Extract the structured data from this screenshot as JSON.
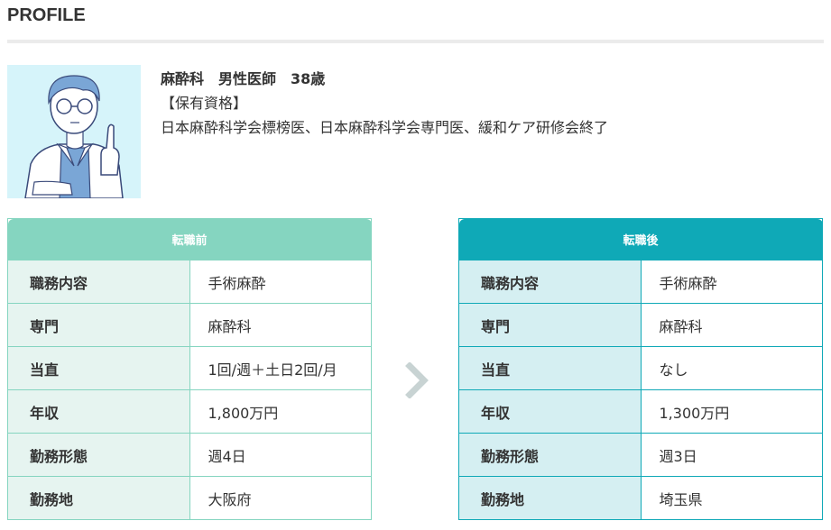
{
  "heading": "PROFILE",
  "profile": {
    "specialty": "麻酔科",
    "gender": "男性医師",
    "age": "38歳",
    "qual_label": "【保有資格】",
    "qualifications": "日本麻酔科学会標榜医、日本麻酔科学会専門医、緩和ケア研修会終了",
    "avatar_icon": "doctor-illustration"
  },
  "before": {
    "title": "転職前",
    "rows": [
      {
        "label": "職務内容",
        "value": "手術麻酔"
      },
      {
        "label": "専門",
        "value": "麻酔科"
      },
      {
        "label": "当直",
        "value": "1回/週＋土日2回/月"
      },
      {
        "label": "年収",
        "value": "1,800万円"
      },
      {
        "label": "勤務形態",
        "value": "週4日"
      },
      {
        "label": "勤務地",
        "value": "大阪府"
      }
    ]
  },
  "after": {
    "title": "転職後",
    "rows": [
      {
        "label": "職務内容",
        "value": "手術麻酔"
      },
      {
        "label": "専門",
        "value": "麻酔科"
      },
      {
        "label": "当直",
        "value": "なし"
      },
      {
        "label": "年収",
        "value": "1,300万円"
      },
      {
        "label": "勤務形態",
        "value": "週3日"
      },
      {
        "label": "勤務地",
        "value": "埼玉県"
      }
    ]
  },
  "colors": {
    "before_accent": "#85d5c0",
    "after_accent": "#0fa9b7",
    "arrow": "#c8d3d3"
  }
}
